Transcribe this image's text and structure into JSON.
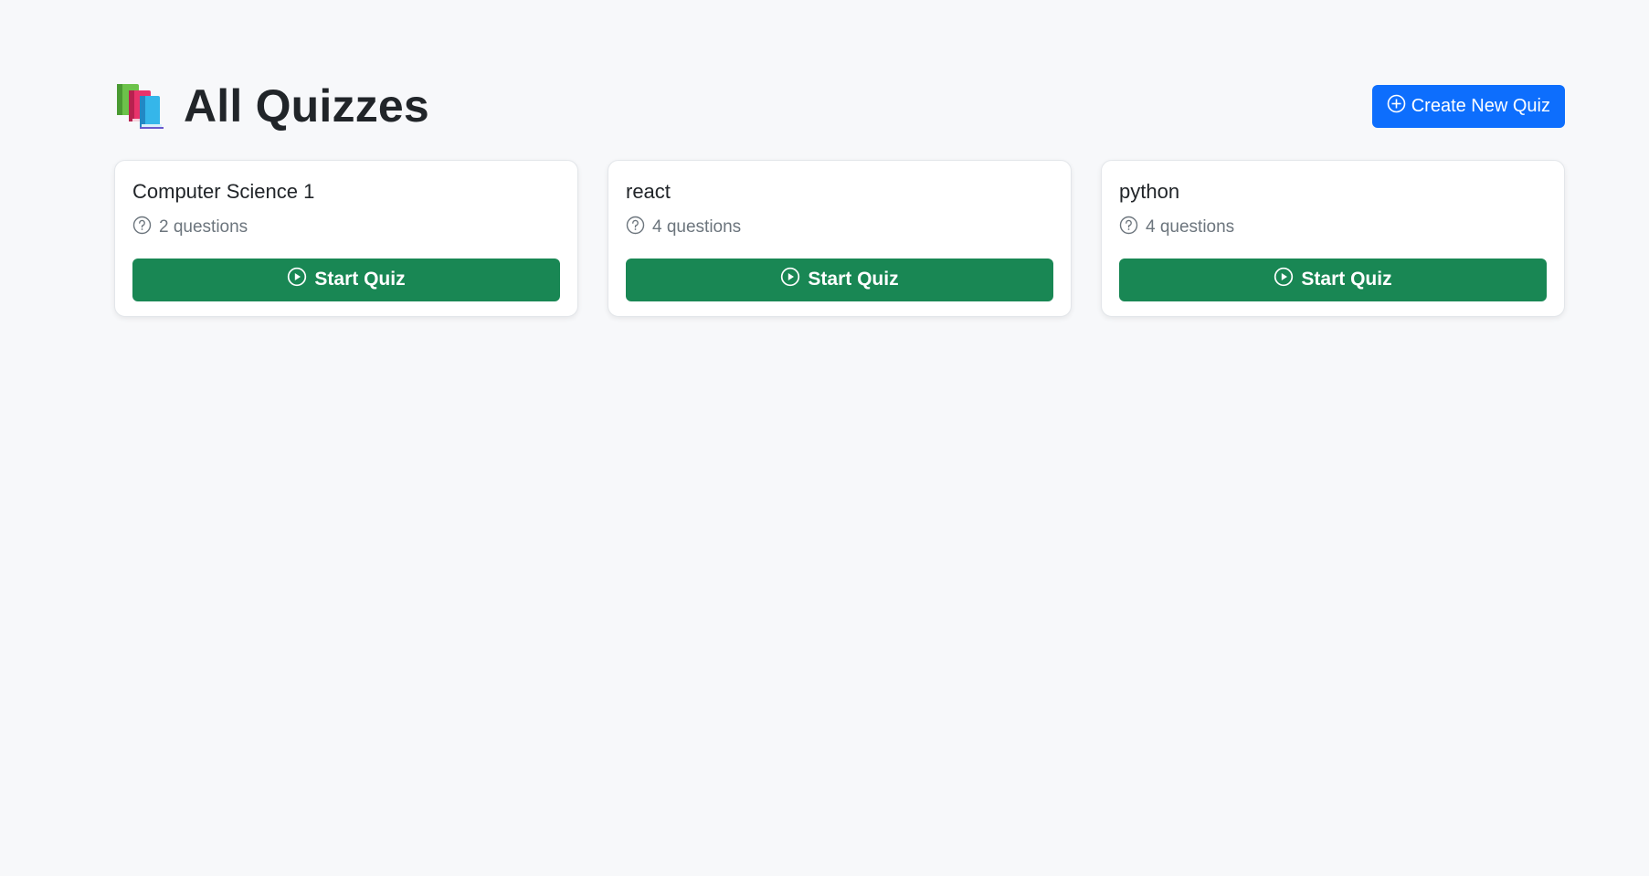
{
  "header": {
    "title": "All Quizzes",
    "title_icon": "books-icon",
    "create_button_label": "Create New Quiz",
    "create_button_icon": "plus-circle-icon"
  },
  "colors": {
    "page_background": "#f7f8fa",
    "primary": "#0d6efd",
    "success": "#198754",
    "muted_text": "#6c757d"
  },
  "quizzes": [
    {
      "title": "Computer Science 1",
      "questions": "2 questions",
      "start_label": "Start Quiz"
    },
    {
      "title": "react",
      "questions": "4 questions",
      "start_label": "Start Quiz"
    },
    {
      "title": "python",
      "questions": "4 questions",
      "start_label": "Start Quiz"
    }
  ]
}
